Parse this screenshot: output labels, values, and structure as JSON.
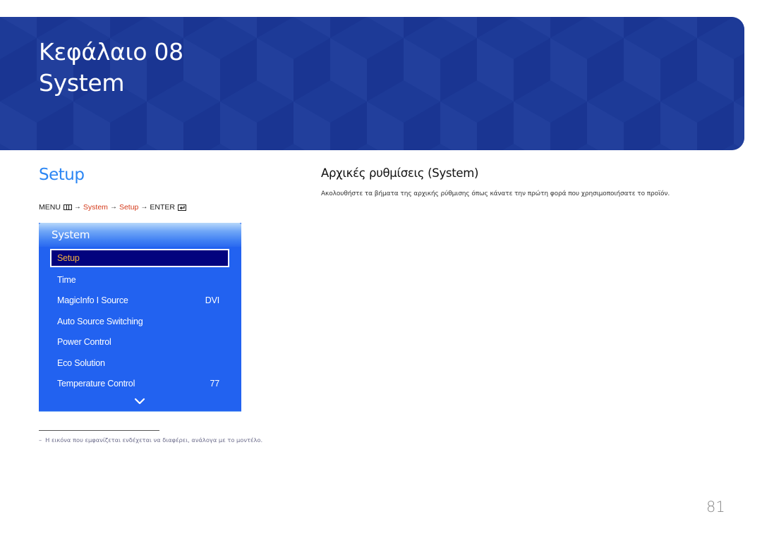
{
  "banner": {
    "chapter": "Κεφάλαιο 08",
    "title": "System",
    "color": "#1f3d9b"
  },
  "section": {
    "title": "Setup",
    "title_color": "#2b86f4"
  },
  "menu_path": {
    "menu_label": "MENU",
    "menu_icon": "menu-grid-icon",
    "arrow": "→",
    "steps": [
      "System",
      "Setup"
    ],
    "enter_label": "ENTER",
    "enter_icon": "enter-icon",
    "highlight_color": "#d43a1a"
  },
  "osd_menu": {
    "title": "System",
    "items": [
      {
        "label": "Setup",
        "value": "",
        "selected": true
      },
      {
        "label": "Time",
        "value": ""
      },
      {
        "label": "MagicInfo I Source",
        "value": "DVI"
      },
      {
        "label": "Auto Source Switching",
        "value": ""
      },
      {
        "label": "Power Control",
        "value": ""
      },
      {
        "label": "Eco Solution",
        "value": ""
      },
      {
        "label": "Temperature Control",
        "value": "77"
      }
    ],
    "scroll_icon": "chevron-down-icon",
    "colors": {
      "panel": "#2262f0",
      "selected_bg": "#02037e",
      "selected_text": "#f4b13c"
    }
  },
  "right": {
    "title": "Αρχικές ρυθμίσεις (System)",
    "description": "Ακολουθήστε τα βήματα της αρχικής ρύθμισης όπως κάνατε την πρώτη φορά που χρησιμοποιήσατε το προϊόν."
  },
  "footnote": {
    "dash": "–",
    "text": "Η εικόνα που εμφανίζεται ενδέχεται να διαφέρει, ανάλογα με το μοντέλο."
  },
  "page_number": "81"
}
